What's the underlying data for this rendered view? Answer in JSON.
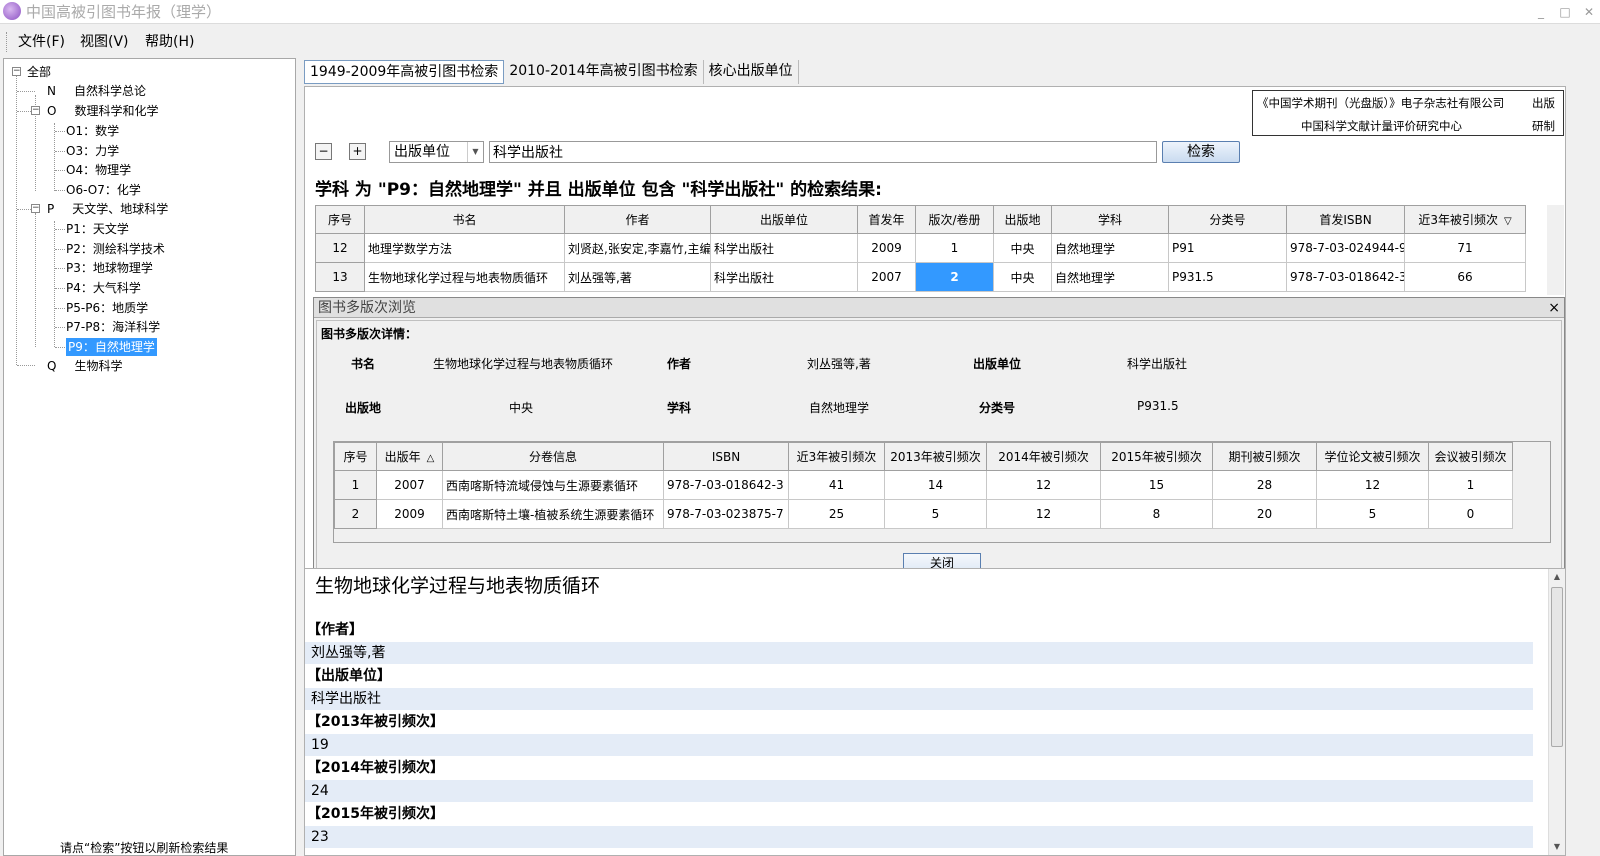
{
  "window": {
    "title": "中国高被引图书年报（理学）",
    "minimize": "_",
    "maximize": "□",
    "close": "✕"
  },
  "menu": [
    "文件(F)",
    "视图(V)",
    "帮助(H)"
  ],
  "tree": {
    "root": "全部",
    "n": {
      "code": "N",
      "label": "自然科学总论"
    },
    "o": {
      "code": "O",
      "label": "数理科学和化学",
      "children": [
        "O1：数学",
        "O3：力学",
        "O4：物理学",
        "O6-O7：化学"
      ]
    },
    "p": {
      "code": "P",
      "label": "天文学、地球科学",
      "children": [
        "P1：天文学",
        "P2：测绘科学技术",
        "P3：地球物理学",
        "P4：大气科学",
        "P5-P6：地质学",
        "P7-P8：海洋科学",
        "P9：自然地理学"
      ]
    },
    "q": {
      "code": "Q",
      "label": "生物科学"
    },
    "status": "请点“检索”按钮以刷新检索结果"
  },
  "tabs": [
    "1949-2009年高被引图书检索",
    "2010-2014年高被引图书检索",
    "核心出版单位"
  ],
  "publisher_info": {
    "line1": "《中国学术期刊（光盘版）》电子杂志社有限公司",
    "line1_suffix": "出版",
    "line2": "中国科学文献计量评价研究中心",
    "line2_suffix": "研制"
  },
  "search": {
    "minus": "−",
    "plus": "+",
    "field": "出版单位",
    "query": "科学出版社",
    "button": "检索"
  },
  "result_heading": "学科 为 \"P9：自然地理学\" 并且 出版单位 包含 \"科学出版社\" 的检索结果:",
  "results": {
    "columns": [
      "序号",
      "书名",
      "作者",
      "出版单位",
      "首发年",
      "版次/卷册",
      "出版地",
      "学科",
      "分类号",
      "首发ISBN",
      "近3年被引频次"
    ],
    "sort_indicator": "▽",
    "rows": [
      [
        "12",
        "地理学数学方法",
        "刘贤赵,张安定,李嘉竹,主编",
        "科学出版社",
        "2009",
        "1",
        "中央",
        "自然地理学",
        "P91",
        "978-7-03-024944-9",
        "71"
      ],
      [
        "13",
        "生物地球化学过程与地表物质循环",
        "刘丛强等,著",
        "科学出版社",
        "2007",
        "2",
        "中央",
        "自然地理学",
        "P931.5",
        "978-7-03-018642-3",
        "66"
      ]
    ]
  },
  "dialog": {
    "title": "图书多版次浏览",
    "close_x": "×",
    "section": "图书多版次详情：",
    "labels": {
      "title": "书名",
      "author": "作者",
      "publisher": "出版单位",
      "place": "出版地",
      "subject": "学科",
      "class": "分类号"
    },
    "values": {
      "title": "生物地球化学过程与地表物质循环",
      "author": "刘丛强等,著",
      "publisher": "科学出版社",
      "place": "中央",
      "subject": "自然地理学",
      "class": "P931.5"
    },
    "columns": [
      "序号",
      "出版年",
      "分卷信息",
      "ISBN",
      "近3年被引频次",
      "2013年被引频次",
      "2014年被引频次",
      "2015年被引频次",
      "期刊被引频次",
      "学位论文被引频次",
      "会议被引频次"
    ],
    "sort_indicator": "△",
    "rows": [
      [
        "1",
        "2007",
        "西南喀斯特流域侵蚀与生源要素循环",
        "978-7-03-018642-3",
        "41",
        "14",
        "12",
        "15",
        "28",
        "12",
        "1"
      ],
      [
        "2",
        "2009",
        "西南喀斯特土壤-植被系统生源要素循环",
        "978-7-03-023875-7",
        "25",
        "5",
        "12",
        "8",
        "20",
        "5",
        "0"
      ]
    ],
    "close_button": "关闭"
  },
  "detail": {
    "title": "生物地球化学过程与地表物质循环",
    "fields": [
      {
        "label": "【作者】",
        "value": "刘丛强等,著"
      },
      {
        "label": "【出版单位】",
        "value": "科学出版社"
      },
      {
        "label": "【2013年被引频次】",
        "value": "19"
      },
      {
        "label": "【2014年被引频次】",
        "value": "24"
      },
      {
        "label": "【2015年被引频次】",
        "value": "23"
      }
    ]
  },
  "colors": {
    "selection": "#3399ff",
    "detail_stripe": "#e4ecf7"
  }
}
